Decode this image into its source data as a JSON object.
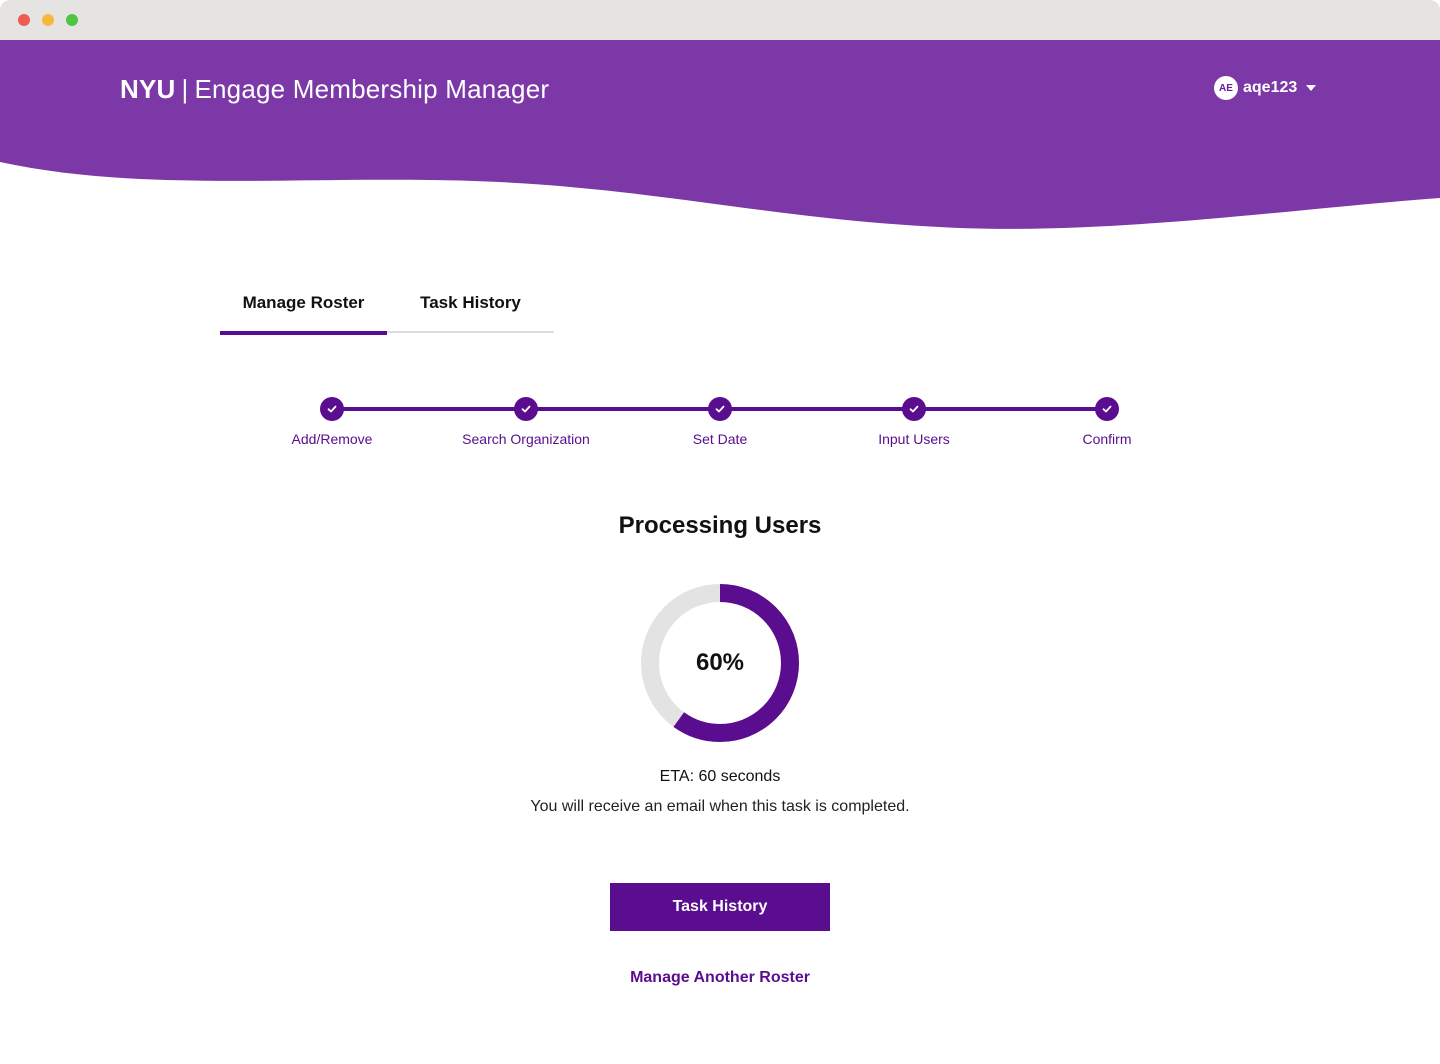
{
  "app": {
    "brand": "NYU",
    "separator": "|",
    "name": "Engage Membership Manager"
  },
  "user": {
    "initials": "AE",
    "username": "aqe123"
  },
  "tabs": [
    {
      "label": "Manage Roster",
      "active": true
    },
    {
      "label": "Task History",
      "active": false
    }
  ],
  "steps": [
    {
      "label": "Add/Remove",
      "done": true
    },
    {
      "label": "Search Organization",
      "done": true
    },
    {
      "label": "Set Date",
      "done": true
    },
    {
      "label": "Input Users",
      "done": true
    },
    {
      "label": "Confirm",
      "done": true
    }
  ],
  "main": {
    "title": "Processing Users",
    "progress": 0.6,
    "progress_label": "60%",
    "eta": "ETA: 60 seconds",
    "note": "You will receive an email when this task is completed."
  },
  "actions": {
    "primary_label": "Task History",
    "secondary_label": "Manage Another Roster"
  },
  "colors": {
    "header": "#7b38a6",
    "accent": "#5a0d8e",
    "track": "#e3e3e3"
  },
  "icons": {
    "step": "check-icon",
    "menu": "chevron-down-icon"
  }
}
